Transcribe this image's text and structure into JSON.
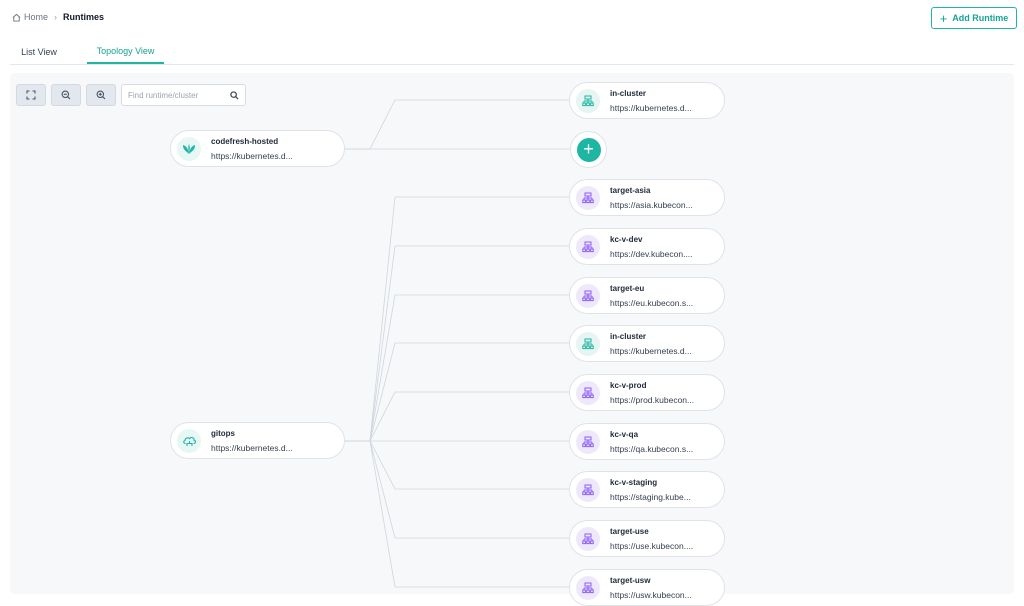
{
  "breadcrumb": {
    "home": "Home",
    "separator": "›",
    "current": "Runtimes"
  },
  "header": {
    "add_button_label": "Add Runtime",
    "add_button_icon": "plus-icon"
  },
  "tabs": [
    {
      "label": "List View",
      "active": false
    },
    {
      "label": "Topology View",
      "active": true
    }
  ],
  "toolbar": {
    "fit_icon": "fit-view-icon",
    "zoom_out_icon": "zoom-out-icon",
    "zoom_in_icon": "zoom-in-icon",
    "search_placeholder": "Find runtime/cluster",
    "search_icon": "search-icon"
  },
  "colors": {
    "accent": "#1fb5a3",
    "cluster_icon_purple": "#8b5cf6",
    "cluster_icon_teal": "#1fb5a3",
    "canvas_bg": "#f7f8fa"
  },
  "runtimes": [
    {
      "name": "codefresh-hosted",
      "url": "https://kubernetes.d...",
      "icon": "codefresh-leaf-icon"
    },
    {
      "name": "gitops",
      "url": "https://kubernetes.d...",
      "icon": "cloud-runtime-icon"
    }
  ],
  "clusters": [
    {
      "name": "in-cluster",
      "url": "https://kubernetes.d...",
      "runtime": "codefresh-hosted",
      "icon": "cluster-icon",
      "color": "teal"
    },
    {
      "name": "target-asia",
      "url": "https://asia.kubecon...",
      "runtime": "gitops",
      "icon": "cluster-icon",
      "color": "purple"
    },
    {
      "name": "kc-v-dev",
      "url": "https://dev.kubecon....",
      "runtime": "gitops",
      "icon": "cluster-icon",
      "color": "purple"
    },
    {
      "name": "target-eu",
      "url": "https://eu.kubecon.s...",
      "runtime": "gitops",
      "icon": "cluster-icon",
      "color": "purple"
    },
    {
      "name": "in-cluster",
      "url": "https://kubernetes.d...",
      "runtime": "gitops",
      "icon": "cluster-icon",
      "color": "teal"
    },
    {
      "name": "kc-v-prod",
      "url": "https://prod.kubecon...",
      "runtime": "gitops",
      "icon": "cluster-icon",
      "color": "purple"
    },
    {
      "name": "kc-v-qa",
      "url": "https://qa.kubecon.s...",
      "runtime": "gitops",
      "icon": "cluster-icon",
      "color": "purple"
    },
    {
      "name": "kc-v-staging",
      "url": "https://staging.kube...",
      "runtime": "gitops",
      "icon": "cluster-icon",
      "color": "purple"
    },
    {
      "name": "target-use",
      "url": "https://use.kubecon....",
      "runtime": "gitops",
      "icon": "cluster-icon",
      "color": "purple"
    },
    {
      "name": "target-usw",
      "url": "https://usw.kubecon...",
      "runtime": "gitops",
      "icon": "cluster-icon",
      "color": "purple"
    }
  ],
  "add_cluster_icon": "add-cluster-icon"
}
